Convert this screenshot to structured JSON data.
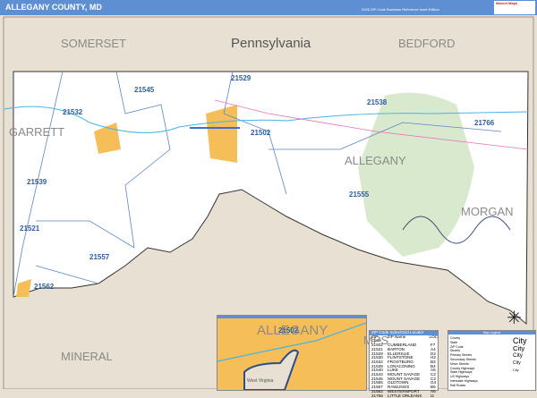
{
  "header": {
    "title": "ALLEGANY COUNTY, MD",
    "subtitle": "2026 ZIP Code Business Reference Inset Edition",
    "logo_text": "Market Maps"
  },
  "map": {
    "region_labels": [
      "SOMERSET",
      "Pennsylvania",
      "BEDFORD",
      "GARRETT",
      "ALLEGANY",
      "MORGAN",
      "MPS",
      "MINERAL"
    ],
    "zip_labels": [
      "21545",
      "21529",
      "21532",
      "21538",
      "21766",
      "21502",
      "21539",
      "21555",
      "21521",
      "21557",
      "21562"
    ],
    "colors": {
      "county": "#ffffff",
      "neighbor": "#e7e0d3",
      "urban": "#f6be58",
      "park": "#cfe3c0",
      "zip_boundary": "#5b86c4",
      "header": "#5f8fd3"
    }
  },
  "inset": {
    "zip": "21502",
    "county_label": "ALLEGANY",
    "state_label": "West Virginia"
  },
  "zip_table": {
    "title": "ZIP Code Index/Grid Locator",
    "columns": [
      "ZIP Code",
      "ZIP Name",
      "LOC"
    ],
    "rows": [
      [
        "21502",
        "CUMBERLAND",
        "F7"
      ],
      [
        "21521",
        "BARTON",
        "A4"
      ],
      [
        "21529",
        "ELLERSLIE",
        "D2"
      ],
      [
        "21530",
        "FLINTSTONE",
        "H2"
      ],
      [
        "21532",
        "FROSTBURG",
        "B3"
      ],
      [
        "21539",
        "LONACONING",
        "B4"
      ],
      [
        "21540",
        "LUKE",
        "A6"
      ],
      [
        "21543",
        "MOUNT SAVAGE",
        "C2"
      ],
      [
        "21545",
        "MOUNT SAVAGE",
        "C2"
      ],
      [
        "21555",
        "OLDTOWN",
        "G4"
      ],
      [
        "21557",
        "RAWLINGS",
        "B5"
      ],
      [
        "21562",
        "WESTERNPORT",
        "A6"
      ],
      [
        "21766",
        "LITTLE ORLEANS",
        "I2"
      ]
    ]
  },
  "legend": {
    "title": "Map Legend",
    "items": [
      "County",
      "State",
      "ZIP Code",
      "Streets",
      "Primary Streets",
      "Secondary Streets",
      "Minor Streets",
      "County Highways",
      "State Highways",
      "US Highways",
      "Interstate Highways",
      "Rail Roads"
    ],
    "city_items": [
      "City",
      "City",
      "City",
      "City",
      "City"
    ]
  }
}
